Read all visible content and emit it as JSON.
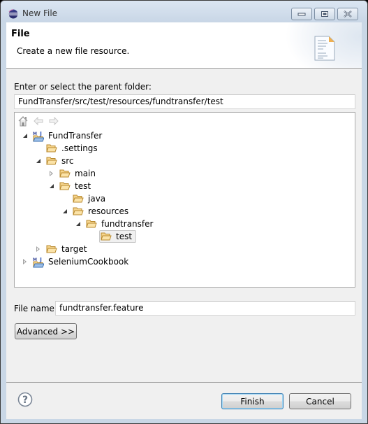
{
  "window": {
    "title": "New File",
    "controls": {
      "minimize": "minimize",
      "maximize": "maximize",
      "close": "close"
    }
  },
  "header": {
    "title": "File",
    "description": "Create a new file resource."
  },
  "parent_folder": {
    "label": "Enter or select the parent folder:",
    "value": "FundTransfer/src/test/resources/fundtransfer/test"
  },
  "tree": {
    "toolbar": [
      "home-icon",
      "back-icon",
      "forward-icon"
    ],
    "nodes": [
      {
        "label": "FundTransfer",
        "type": "project",
        "depth": 0,
        "state": "open"
      },
      {
        "label": ".settings",
        "type": "folder",
        "depth": 1,
        "state": "none"
      },
      {
        "label": "src",
        "type": "folder",
        "depth": 1,
        "state": "open"
      },
      {
        "label": "main",
        "type": "folder",
        "depth": 2,
        "state": "closed"
      },
      {
        "label": "test",
        "type": "folder",
        "depth": 2,
        "state": "open"
      },
      {
        "label": "java",
        "type": "folder",
        "depth": 3,
        "state": "none"
      },
      {
        "label": "resources",
        "type": "folder",
        "depth": 3,
        "state": "open"
      },
      {
        "label": "fundtransfer",
        "type": "folder",
        "depth": 4,
        "state": "open"
      },
      {
        "label": "test",
        "type": "folder",
        "depth": 5,
        "state": "none",
        "selected": true
      },
      {
        "label": "target",
        "type": "folder",
        "depth": 1,
        "state": "closed"
      },
      {
        "label": "SeleniumCookbook",
        "type": "project",
        "depth": 0,
        "state": "closed"
      }
    ]
  },
  "file_name": {
    "label": "File name:",
    "value": "fundtransfer.feature"
  },
  "buttons": {
    "advanced": "Advanced >>",
    "finish": "Finish",
    "cancel": "Cancel"
  },
  "colors": {
    "accent_default_button": "#3c7fb1",
    "folder": "#e8b85a",
    "dialog_bg": "#f0f0f0"
  }
}
